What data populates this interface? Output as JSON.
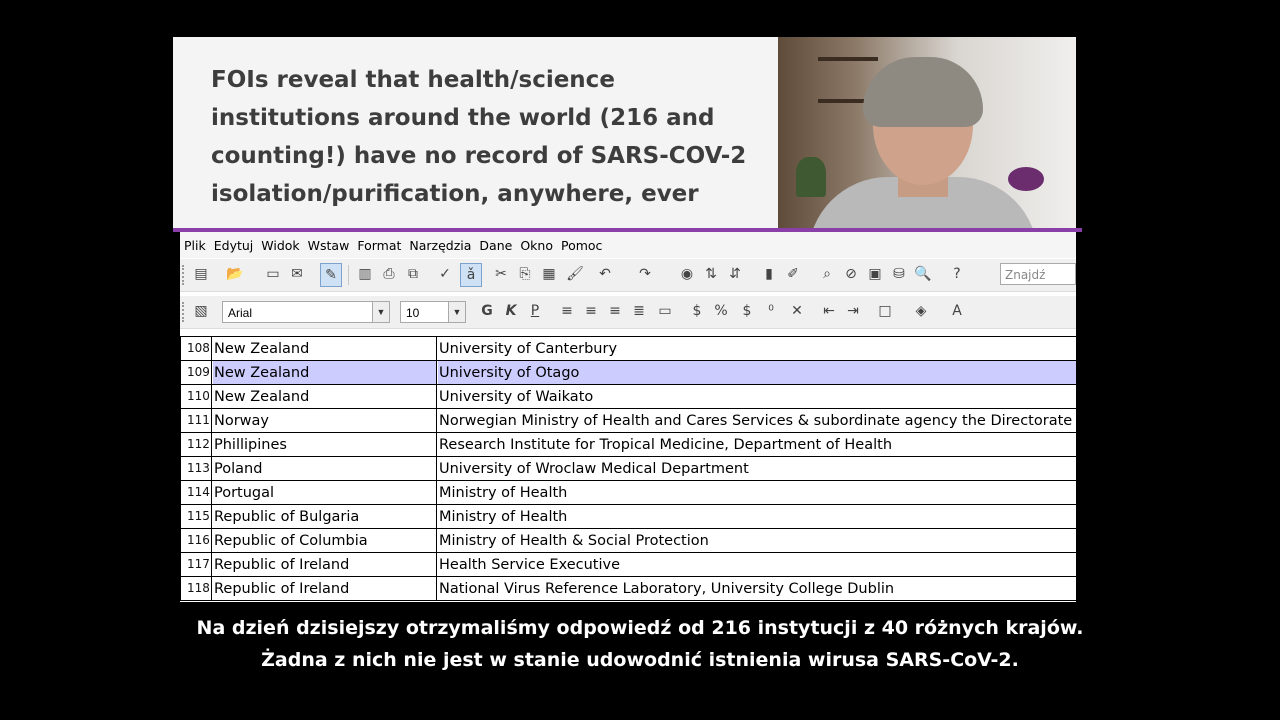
{
  "slide": {
    "headline": "FOIs reveal that health/science institutions around the world (216 and counting!) have no record of SARS-COV-2 isolation/purification, anywhere, ever"
  },
  "menubar": [
    "Plik",
    "Edytuj",
    "Widok",
    "Wstaw",
    "Format",
    "Narzędzia",
    "Dane",
    "Okno",
    "Pomoc"
  ],
  "toolbar": {
    "find_placeholder": "Znajdź",
    "font_name": "Arial",
    "font_size": "10",
    "bold_label": "G",
    "italic_label": "K",
    "underline_label": "P"
  },
  "table": {
    "rows": [
      {
        "num": "108",
        "country": "New Zealand",
        "institution": "University of Canterbury"
      },
      {
        "num": "109",
        "country": "New Zealand",
        "institution": "University of Otago",
        "selected": true
      },
      {
        "num": "110",
        "country": "New Zealand",
        "institution": "University of Waikato"
      },
      {
        "num": "111",
        "country": "Norway",
        "institution": "Norwegian Ministry of Health and Cares Services & subordinate agency the Directorate of Health"
      },
      {
        "num": "112",
        "country": "Phillipines",
        "institution": "Research Institute for Tropical Medicine, Department of Health"
      },
      {
        "num": "113",
        "country": "Poland",
        "institution": "University of Wroclaw Medical Department"
      },
      {
        "num": "114",
        "country": "Portugal",
        "institution": "Ministry of Health"
      },
      {
        "num": "115",
        "country": "Republic of Bulgaria",
        "institution": "Ministry of Health"
      },
      {
        "num": "116",
        "country": "Republic of Columbia",
        "institution": "Ministry of Health & Social Protection"
      },
      {
        "num": "117",
        "country": "Republic of Ireland",
        "institution": "Health Service Executive"
      },
      {
        "num": "118",
        "country": "Republic of Ireland",
        "institution": "National Virus Reference Laboratory, University College Dublin"
      }
    ]
  },
  "subtitles": {
    "line1": "Na dzień dzisiejszy otrzymaliśmy odpowiedź od 216 instytucji z 40 różnych krajów.",
    "line2": "Żadna z nich nie jest w stanie udowodnić istnienia wirusa SARS-CoV-2."
  },
  "colors": {
    "accent_line": "#8a3fa8",
    "selected_row": "#ccccff",
    "headline_text": "#3d3d3d"
  }
}
